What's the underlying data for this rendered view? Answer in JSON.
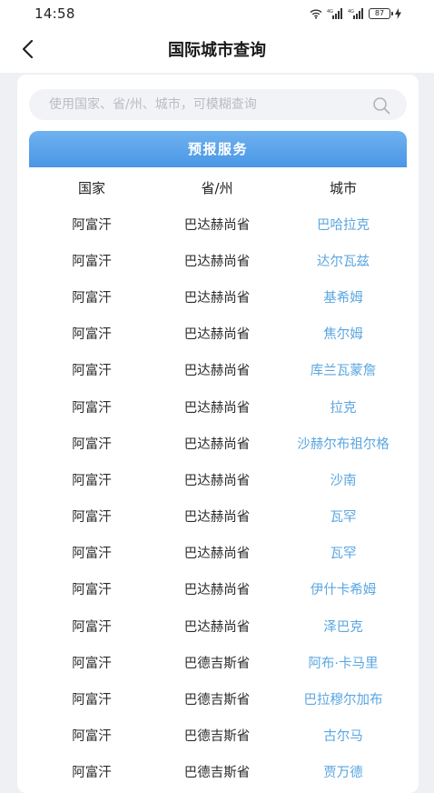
{
  "status_bar": {
    "time": "14:58",
    "battery_level": "87",
    "icons": [
      "wifi-icon",
      "signal-icon",
      "signal-icon",
      "battery-icon",
      "charging-icon"
    ]
  },
  "nav": {
    "title": "国际城市查询",
    "back_icon": "chevron-left-icon"
  },
  "search": {
    "placeholder": "使用国家、省/州、城市，可模糊查询",
    "value": "",
    "icon": "search-icon"
  },
  "forecast": {
    "header": "预报服务"
  },
  "table": {
    "columns": [
      "国家",
      "省/州",
      "城市"
    ],
    "rows": [
      {
        "country": "阿富汗",
        "province": "巴达赫尚省",
        "city": "巴哈拉克"
      },
      {
        "country": "阿富汗",
        "province": "巴达赫尚省",
        "city": "达尔瓦兹"
      },
      {
        "country": "阿富汗",
        "province": "巴达赫尚省",
        "city": "基希姆"
      },
      {
        "country": "阿富汗",
        "province": "巴达赫尚省",
        "city": "焦尔姆"
      },
      {
        "country": "阿富汗",
        "province": "巴达赫尚省",
        "city": "库兰瓦蒙詹"
      },
      {
        "country": "阿富汗",
        "province": "巴达赫尚省",
        "city": "拉克"
      },
      {
        "country": "阿富汗",
        "province": "巴达赫尚省",
        "city": "沙赫尔布祖尔格"
      },
      {
        "country": "阿富汗",
        "province": "巴达赫尚省",
        "city": "沙南"
      },
      {
        "country": "阿富汗",
        "province": "巴达赫尚省",
        "city": "瓦罕"
      },
      {
        "country": "阿富汗",
        "province": "巴达赫尚省",
        "city": "瓦罕"
      },
      {
        "country": "阿富汗",
        "province": "巴达赫尚省",
        "city": "伊什卡希姆"
      },
      {
        "country": "阿富汗",
        "province": "巴达赫尚省",
        "city": "泽巴克"
      },
      {
        "country": "阿富汗",
        "province": "巴德吉斯省",
        "city": "阿布·卡马里"
      },
      {
        "country": "阿富汗",
        "province": "巴德吉斯省",
        "city": "巴拉穆尔加布"
      },
      {
        "country": "阿富汗",
        "province": "巴德吉斯省",
        "city": "古尔马"
      },
      {
        "country": "阿富汗",
        "province": "巴德吉斯省",
        "city": "贾万德"
      }
    ]
  },
  "colors": {
    "accent": "#4a96e6",
    "link": "#5aa6e0",
    "background": "#eef0f4"
  }
}
